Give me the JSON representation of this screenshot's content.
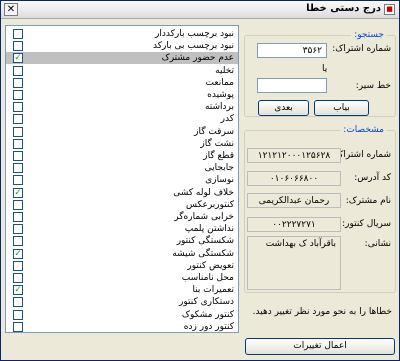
{
  "window": {
    "title": "درج دستی خطا",
    "close_glyph": "✕",
    "icon_glyph": "■"
  },
  "checklist": {
    "items": [
      {
        "label": "نبود برچسب بارکددار",
        "checked": false,
        "selected": false
      },
      {
        "label": "نبود برچسب بی بارکد",
        "checked": false,
        "selected": false
      },
      {
        "label": "عدم حضور مشترک",
        "checked": true,
        "selected": true
      },
      {
        "label": "تخلیه",
        "checked": false,
        "selected": false
      },
      {
        "label": "ممانعت",
        "checked": false,
        "selected": false
      },
      {
        "label": "پوشیده",
        "checked": false,
        "selected": false
      },
      {
        "label": "برداشته",
        "checked": false,
        "selected": false
      },
      {
        "label": "کدر",
        "checked": false,
        "selected": false
      },
      {
        "label": "سرقت گاز",
        "checked": false,
        "selected": false
      },
      {
        "label": "نشت گاز",
        "checked": false,
        "selected": false
      },
      {
        "label": "قطع گاز",
        "checked": false,
        "selected": false
      },
      {
        "label": "جابجایی",
        "checked": false,
        "selected": false
      },
      {
        "label": "نوسازی",
        "checked": false,
        "selected": false
      },
      {
        "label": "خلاف لوله کشی",
        "checked": true,
        "selected": false
      },
      {
        "label": "کنتوربرعکس",
        "checked": false,
        "selected": false
      },
      {
        "label": "خرابی شماره‌گر",
        "checked": false,
        "selected": false
      },
      {
        "label": "نداشتن پلمپ",
        "checked": false,
        "selected": false
      },
      {
        "label": "شکستگی کنتور",
        "checked": false,
        "selected": false
      },
      {
        "label": "شکستگی شیشه",
        "checked": true,
        "selected": false
      },
      {
        "label": "تعویض کنتور",
        "checked": false,
        "selected": false
      },
      {
        "label": "محل نامناسب",
        "checked": false,
        "selected": false
      },
      {
        "label": "تعمیرات بنا",
        "checked": true,
        "selected": false
      },
      {
        "label": "دستکاری کنتور",
        "checked": false,
        "selected": false
      },
      {
        "label": "کنتور مشکوک",
        "checked": false,
        "selected": false
      },
      {
        "label": "کنتور دور زده",
        "checked": false,
        "selected": false
      }
    ]
  },
  "search": {
    "title": "جستجو:",
    "subscription_label": "شماره اشتراک:",
    "subscription_value": "۳۵۶۲",
    "or_label": "یا",
    "line_label": "خط سیر:",
    "line_value": "",
    "find_button": "بیاب",
    "next_button": "بعدی"
  },
  "details": {
    "title": "مشخصات:",
    "subscription_label": "شماره اشتراک:",
    "subscription_value": "۱۲۱۲۱۲۰۰۰۱۲۵۶۲۸",
    "address_code_label": "کد آدرس:",
    "address_code_value": "۰۱۰۶۰۶۶۸۰۰",
    "customer_name_label": "نام مشترک:",
    "customer_name_value": "رحمان عبدالکریمی",
    "meter_serial_label": "سریال کنتور:",
    "meter_serial_value": "۰۰۲۲۲۷۲۷۱",
    "address_label": "نشانی:",
    "address_value": "باقرآباد ک بهداشت"
  },
  "instruction": "خطاها را به نحو مورد نظر تغییر دهید.",
  "apply_button": "اعمال تغییرات",
  "check_glyph": "✓"
}
